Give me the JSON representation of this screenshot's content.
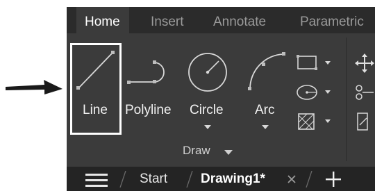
{
  "tabs": [
    {
      "label": "Home",
      "active": true
    },
    {
      "label": "Insert",
      "active": false
    },
    {
      "label": "Annotate",
      "active": false
    },
    {
      "label": "Parametric",
      "active": false
    }
  ],
  "draw_panel": {
    "title": "Draw",
    "tools": {
      "line": "Line",
      "polyline": "Polyline",
      "circle": "Circle",
      "arc": "Arc"
    },
    "highlighted_tool": "Line"
  },
  "icons": {
    "pointer": "arrow-pointing-right-icon",
    "rectangle": "rectangle-icon",
    "ellipse": "ellipse-icon",
    "hatch": "hatch-icon",
    "move": "move-icon",
    "copy": "copy-icon",
    "stretch": "stretch-icon",
    "menu": "hamburger-menu-icon",
    "close": "close-icon",
    "new_tab": "plus-icon"
  },
  "document_tabs": {
    "start": "Start",
    "drawing": "Drawing1*"
  },
  "colors": {
    "ribbon_dark": "#2b2b2b",
    "panel": "#3b3b3b",
    "doc_bar": "#242424",
    "text": "#f2f2f2"
  }
}
